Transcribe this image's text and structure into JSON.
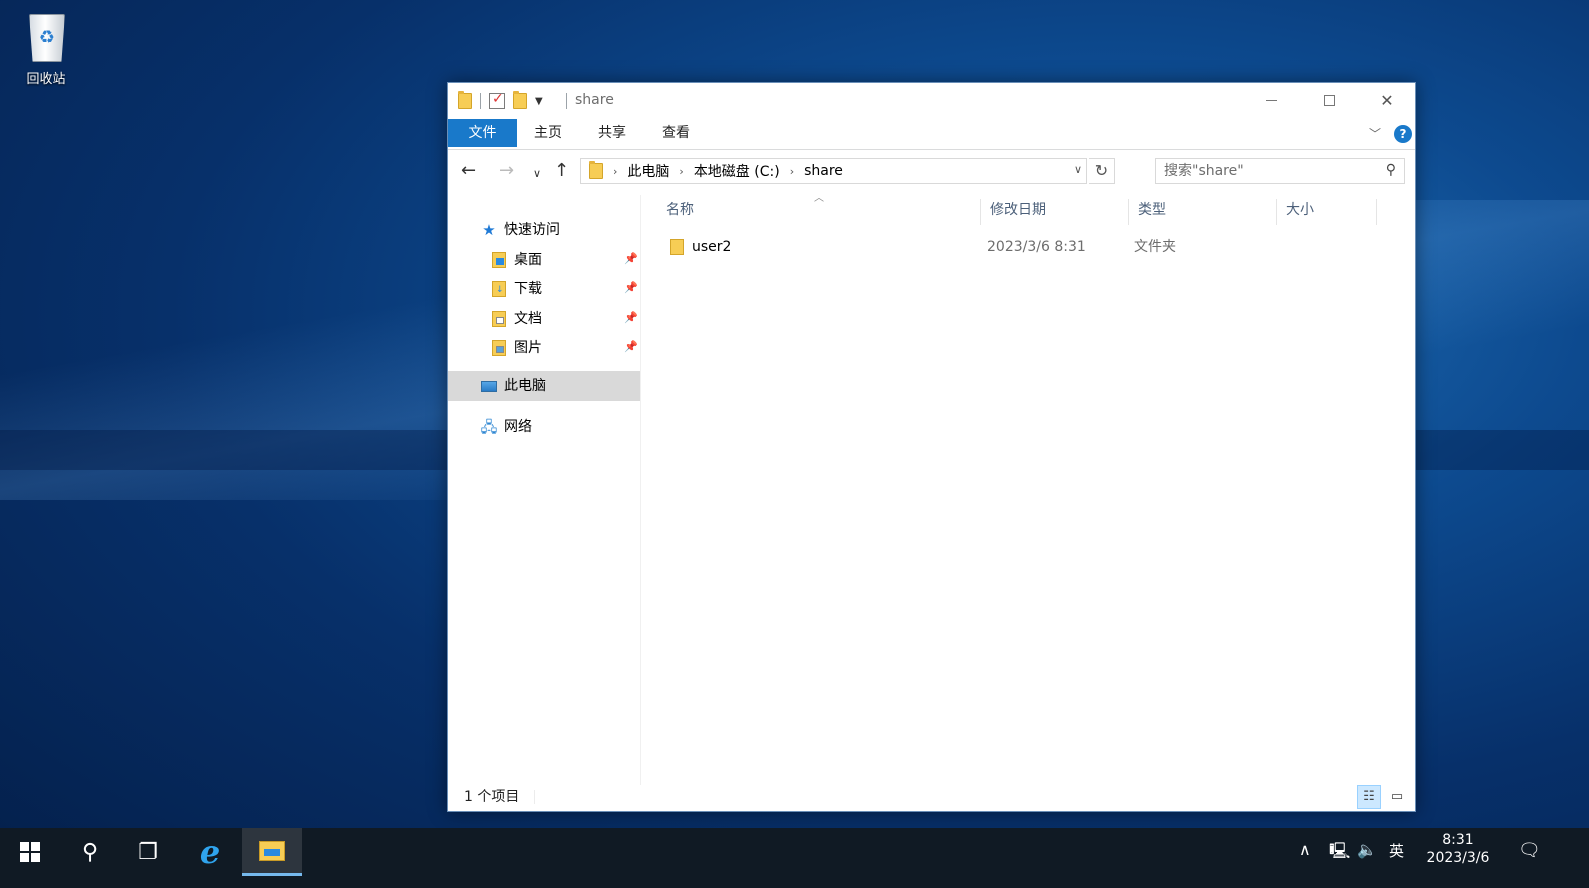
{
  "desktop": {
    "recycle_bin_label": "回收站"
  },
  "window": {
    "title": "share",
    "ribbon_tabs": [
      "文件",
      "主页",
      "共享",
      "查看"
    ],
    "help": "?"
  },
  "navigation": {
    "breadcrumb": [
      "此电脑",
      "本地磁盘 (C:)",
      "share"
    ],
    "search_placeholder": "搜索\"share\""
  },
  "sidebar": {
    "quick_access": "快速访问",
    "pinned": [
      {
        "label": "桌面",
        "icon": "desktop-folder-icon"
      },
      {
        "label": "下载",
        "icon": "downloads-folder-icon"
      },
      {
        "label": "文档",
        "icon": "documents-folder-icon"
      },
      {
        "label": "图片",
        "icon": "pictures-folder-icon"
      }
    ],
    "this_pc": "此电脑",
    "network": "网络"
  },
  "file_list": {
    "columns": [
      "名称",
      "修改日期",
      "类型",
      "大小"
    ],
    "rows": [
      {
        "name": "user2",
        "modified": "2023/3/6 8:31",
        "type": "文件夹",
        "size": ""
      }
    ]
  },
  "status_bar": {
    "item_count": "1 个项目"
  },
  "taskbar": {
    "ime": "英",
    "time": "8:31",
    "date": "2023/3/6"
  }
}
